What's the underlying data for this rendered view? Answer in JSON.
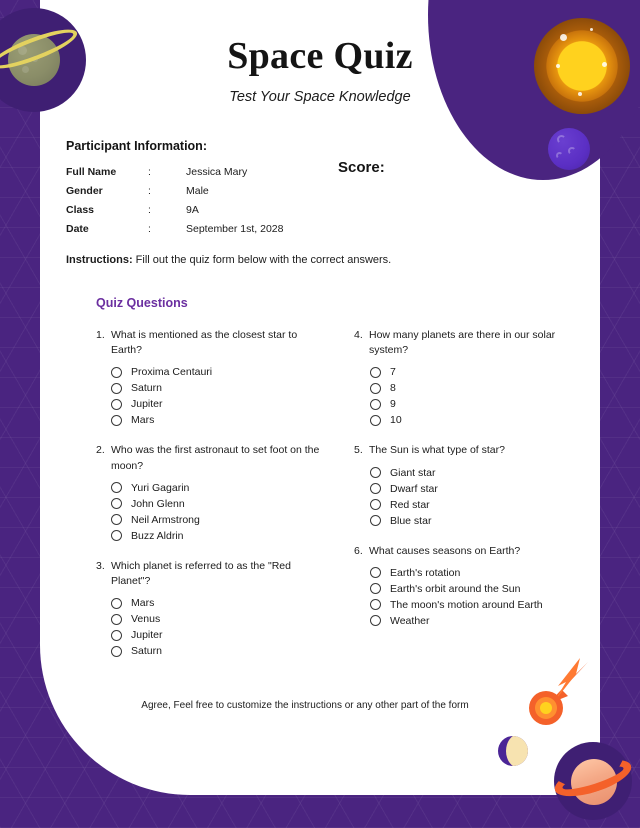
{
  "header": {
    "title": "Space Quiz",
    "subtitle": "Test Your Space Knowledge"
  },
  "participant": {
    "section_label": "Participant Information:",
    "score_label": "Score:",
    "fields": [
      {
        "key": "Full Name",
        "colon": ":",
        "value": "Jessica Mary"
      },
      {
        "key": "Gender",
        "colon": ":",
        "value": "Male"
      },
      {
        "key": "Class",
        "colon": ":",
        "value": "9A"
      },
      {
        "key": "Date",
        "colon": ":",
        "value": "September 1st, 2028"
      }
    ]
  },
  "instructions": {
    "label": "Instructions:",
    "text": " Fill out the quiz form below with the correct answers."
  },
  "quiz": {
    "heading": "Quiz Questions",
    "left_column": [
      {
        "number": "1.",
        "text": "What is mentioned as the closest star to Earth?",
        "options": [
          "Proxima Centauri",
          "Saturn",
          "Jupiter",
          "Mars"
        ]
      },
      {
        "number": "2.",
        "text": "Who was the first astronaut to set foot on the moon?",
        "options": [
          "Yuri Gagarin",
          "John Glenn",
          "Neil Armstrong",
          "Buzz Aldrin"
        ]
      },
      {
        "number": "3.",
        "text": "Which planet is referred to as the \"Red Planet\"?",
        "options": [
          "Mars",
          "Venus",
          "Jupiter",
          "Saturn"
        ]
      }
    ],
    "right_column": [
      {
        "number": "4.",
        "text": "How many planets are there in our solar system?",
        "options": [
          "7",
          "8",
          "9",
          "10"
        ]
      },
      {
        "number": "5.",
        "text": "The Sun is what type of star?",
        "options": [
          "Giant star",
          "Dwarf star",
          "Red star",
          "Blue star"
        ]
      },
      {
        "number": "6.",
        "text": "What causes seasons on Earth?",
        "options": [
          "Earth's rotation",
          "Earth's orbit around the Sun",
          "The moon's motion around Earth",
          "Weather"
        ]
      }
    ]
  },
  "footer": {
    "note": "Agree, Feel free to customize the instructions or any other part of the form"
  },
  "colors": {
    "background_purple": "#4a2480",
    "heading_purple": "#6b2fa0",
    "card_white": "#ffffff",
    "text_dark": "#1c1c1c",
    "sun_yellow": "#ffd21e",
    "comet_orange": "#f4612a"
  }
}
